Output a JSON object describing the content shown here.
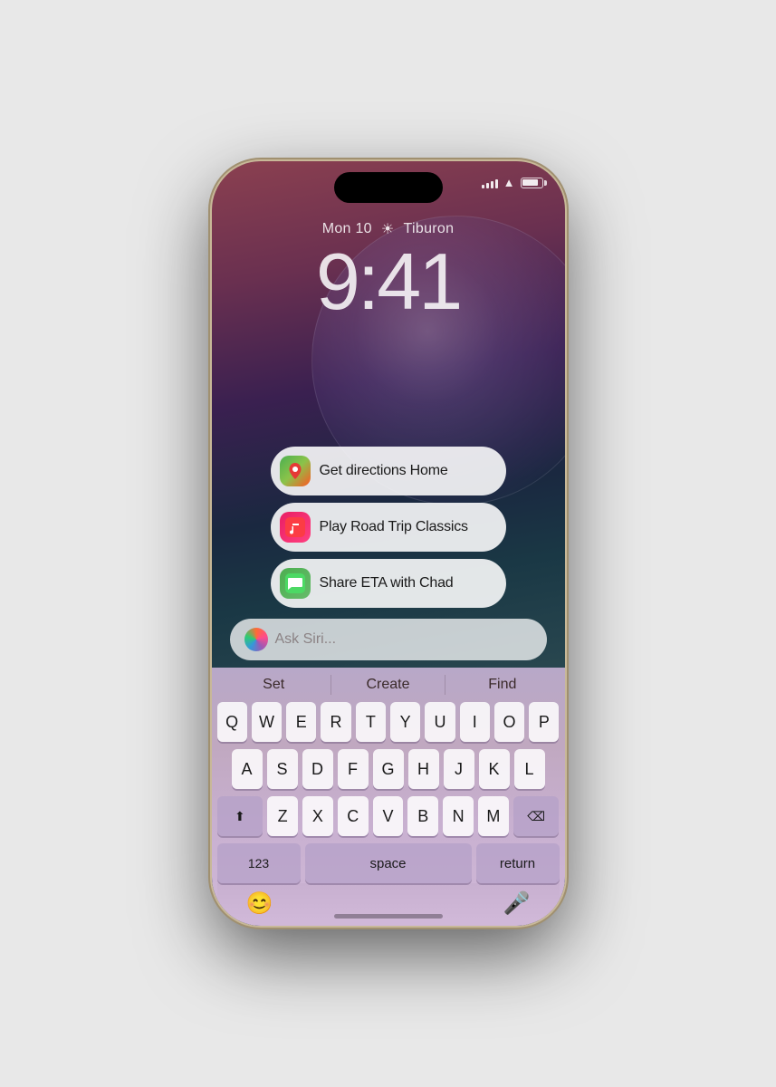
{
  "phone": {
    "status": {
      "time_left": "",
      "signal": "●●●●",
      "wifi": "wifi",
      "battery": "battery"
    },
    "lockscreen": {
      "date_day": "Mon 10",
      "weather_icon": "☀",
      "location": "Tiburon",
      "time": "9:41"
    },
    "siri": {
      "suggestions": [
        {
          "id": "directions",
          "icon_type": "maps",
          "icon_emoji": "🗺",
          "text": "Get directions Home"
        },
        {
          "id": "music",
          "icon_type": "music",
          "icon_emoji": "♪",
          "text": "Play Road Trip Classics"
        },
        {
          "id": "messages",
          "icon_type": "messages",
          "icon_emoji": "💬",
          "text": "Share ETA with Chad"
        }
      ],
      "search_placeholder": "Ask Siri..."
    },
    "keyboard": {
      "suggestions": [
        "Set",
        "Create",
        "Find"
      ],
      "rows": [
        [
          "Q",
          "W",
          "E",
          "R",
          "T",
          "Y",
          "U",
          "I",
          "O",
          "P"
        ],
        [
          "A",
          "S",
          "D",
          "F",
          "G",
          "H",
          "J",
          "K",
          "L"
        ],
        [
          "⇧",
          "Z",
          "X",
          "C",
          "V",
          "B",
          "N",
          "M",
          "⌫"
        ],
        [
          "123",
          "space",
          "return"
        ]
      ]
    },
    "bottom_bar": {
      "emoji_icon": "😊",
      "mic_icon": "🎤"
    }
  }
}
